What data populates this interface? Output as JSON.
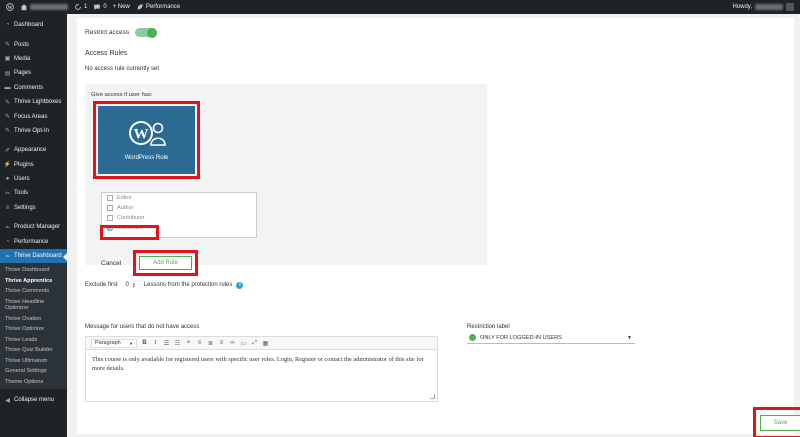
{
  "adminbar": {
    "updates_count": "1",
    "comments_count": "0",
    "new_label": "+ New",
    "performance_label": "Performance",
    "howdy": "Howdy,"
  },
  "sidebar": {
    "items": [
      {
        "label": "Dashboard",
        "icon": "gauge-icon"
      },
      {
        "label": "Posts",
        "icon": "pin-icon"
      },
      {
        "label": "Media",
        "icon": "media-icon"
      },
      {
        "label": "Pages",
        "icon": "page-icon"
      },
      {
        "label": "Comments",
        "icon": "comment-icon"
      },
      {
        "label": "Thrive Lightboxes",
        "icon": "pin-icon"
      },
      {
        "label": "Focus Areas",
        "icon": "pin-icon"
      },
      {
        "label": "Thrive Opt-In",
        "icon": "pin-icon"
      },
      {
        "label": "Appearance",
        "icon": "brush-icon"
      },
      {
        "label": "Plugins",
        "icon": "plug-icon"
      },
      {
        "label": "Users",
        "icon": "user-icon"
      },
      {
        "label": "Tools",
        "icon": "wrench-icon"
      },
      {
        "label": "Settings",
        "icon": "sliders-icon"
      },
      {
        "label": "Product Manager",
        "icon": "leaf-icon"
      },
      {
        "label": "Performance",
        "icon": "gauge-icon"
      },
      {
        "label": "Thrive Dashboard",
        "icon": "leaf-icon"
      }
    ],
    "submenu": [
      "Thrive Dashboard",
      "Thrive Apprentice",
      "Thrive Comments",
      "Thrive Headline Optimizer",
      "Thrive Ovation",
      "Thrive Optimize",
      "Thrive Leads",
      "Thrive Quiz Builder",
      "Thrive Ultimatum",
      "General Settings",
      "Theme Options"
    ],
    "collapse_label": "Collapse menu"
  },
  "content": {
    "restrict_access_label": "Restrict access",
    "access_rules_title": "Access Rules",
    "no_rule_text": "No access rule currently set",
    "give_access_label": "Give access if user has:",
    "wp_role_card_label": "WordPress Role",
    "roles": [
      {
        "label": "Editor",
        "checked": false
      },
      {
        "label": "Author",
        "checked": false
      },
      {
        "label": "Contributor",
        "checked": false
      },
      {
        "label": "Subscriber",
        "checked": true
      }
    ],
    "cancel_label": "Cancel",
    "add_rule_label": "Add Rule",
    "exclude_first_label": "Exclude first",
    "exclude_count": "0",
    "lessons_label": "Lessons from the protection rules",
    "message_label": "Message for users that do not have access",
    "paragraph_select": "Paragraph",
    "message_text": "This course is only available for registered users with specific user roles. Login, Register or contact the administrator of this site for more details.",
    "restriction_label_title": "Restriction label",
    "restriction_option": "ONLY FOR LOGGED-IN USERS",
    "save_label": "Save"
  },
  "colors": {
    "accent_blue": "#2271b1",
    "card_blue": "#2b6a93",
    "green": "#4caf50",
    "highlight_red": "#e1141b"
  }
}
